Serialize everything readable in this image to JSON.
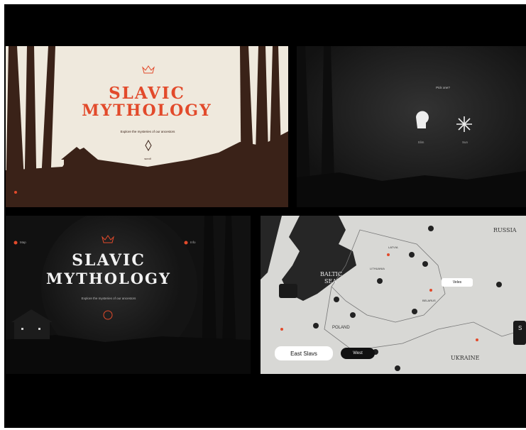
{
  "hero_light": {
    "title_line1": "SLAVIC",
    "title_line2": "MYTHOLOGY",
    "subtitle": "Explore the mysteries of our ancestors",
    "scroll_label": "scroll"
  },
  "dark_choice": {
    "question": "Pick one?",
    "option_left": "Slim",
    "option_right": "Sun"
  },
  "hero_dark": {
    "title_line1": "SLAVIC",
    "title_line2": "MYTHOLOGY",
    "subtitle": "Explore the mysteries of our ancestors",
    "nav_left": "Map",
    "nav_right": "Info"
  },
  "map": {
    "labels": [
      "BALTIC",
      "SEA",
      "RUSSIA",
      "LATVIA",
      "LITHUANIA",
      "BELARUS",
      "POLAND",
      "UKRAINE"
    ],
    "tooltip": "Veles",
    "toggle_button": "East Slavs",
    "secondary_button": "West",
    "side_button": "S"
  },
  "colors": {
    "accent_red": "#e24a2b",
    "cream": "#efe9dd",
    "earth": "#3a2218"
  }
}
